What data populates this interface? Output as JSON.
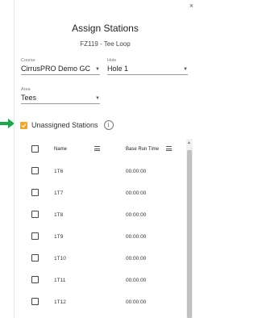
{
  "dialog": {
    "title": "Assign Stations",
    "subtitle": "FZ119 - Tee Loop",
    "close_glyph": "×"
  },
  "fields": {
    "course": {
      "label": "Course",
      "value": "CirrusPRO Demo GC"
    },
    "hole": {
      "label": "Hole",
      "value": "Hole 1"
    },
    "area": {
      "label": "Area",
      "value": "Tees"
    }
  },
  "unassigned": {
    "label": "Unassigned Stations",
    "checked": true,
    "info_glyph": "i"
  },
  "table": {
    "columns": [
      "Name",
      "Base Run Time"
    ],
    "rows": [
      {
        "name": "1T6",
        "time": "00:00:00"
      },
      {
        "name": "1T7",
        "time": "00:00:00"
      },
      {
        "name": "1T8",
        "time": "00:00:00"
      },
      {
        "name": "1T9",
        "time": "00:00:00"
      },
      {
        "name": "1T10",
        "time": "00:00:00"
      },
      {
        "name": "1T11",
        "time": "00:00:00"
      },
      {
        "name": "1T12",
        "time": "00:00:00"
      }
    ]
  },
  "colors": {
    "accent_orange": "#f5a623",
    "arrow_green": "#1aa64a"
  },
  "icons": [
    "close-icon",
    "dropdown-caret-icon",
    "checkbox-icon",
    "info-icon",
    "menu-lines-icon",
    "green-arrow-icon"
  ]
}
